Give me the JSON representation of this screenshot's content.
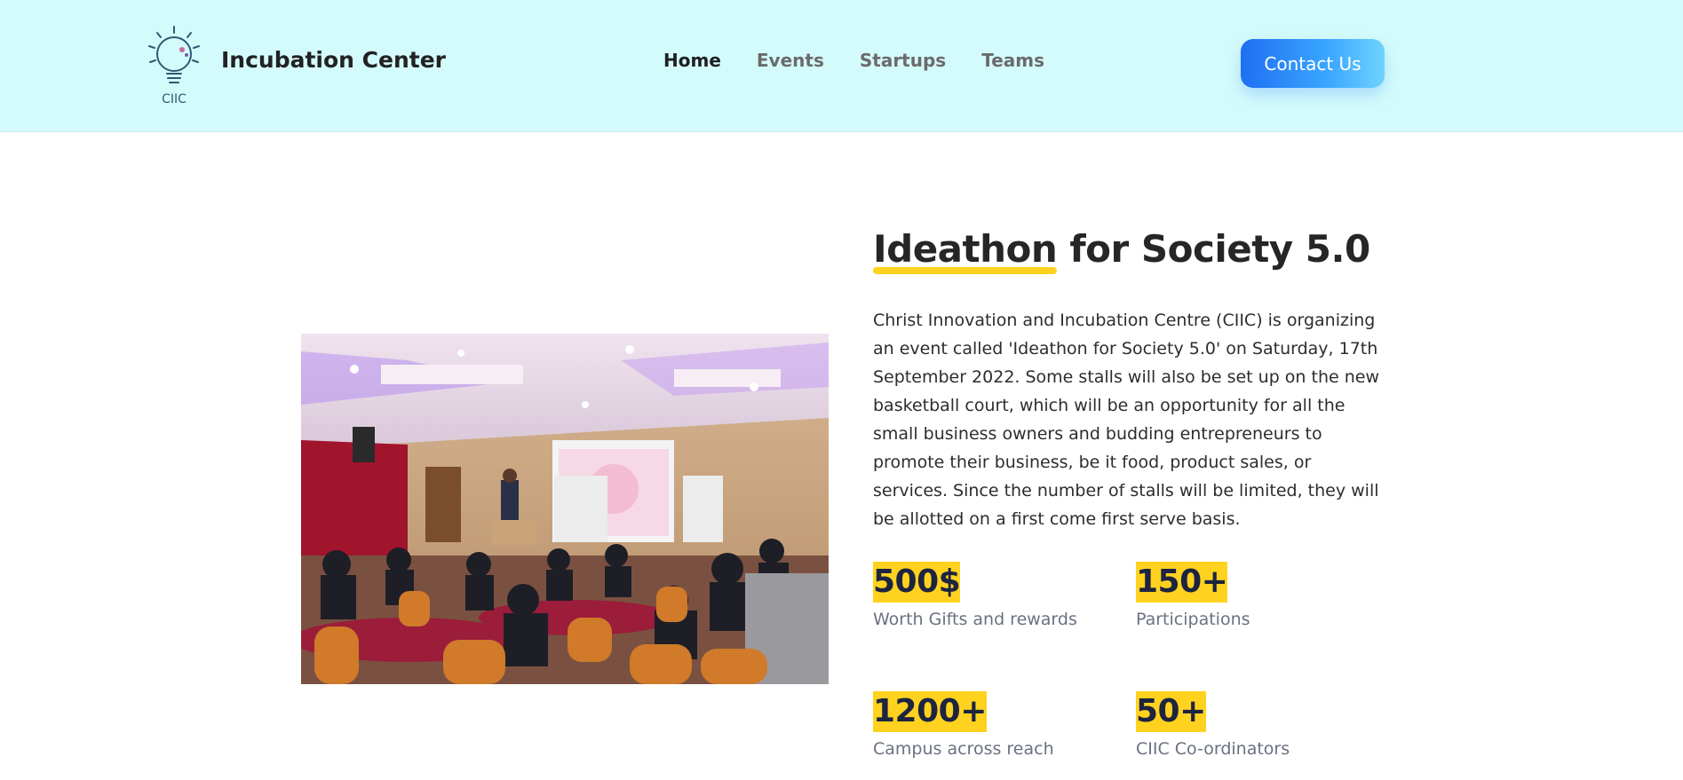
{
  "nav": {
    "brand_logo_text": "CIIC",
    "brand_name": "Incubation Center",
    "links": [
      {
        "label": "Home"
      },
      {
        "label": "Events"
      },
      {
        "label": "Startups"
      },
      {
        "label": "Teams"
      }
    ],
    "contact_label": "Contact Us"
  },
  "hero": {
    "title_highlight": "Ideathon",
    "title_rest": " for Society 5.0",
    "description": "Christ Innovation and Incubation Centre (CIIC) is organizing an event called 'Ideathon for Society 5.0' on Saturday, 17th September 2022. Some stalls will also be set up on the new basketball court, which will be an opportunity for all the small business owners and budding entrepreneurs to promote their business, be it food, product sales, or services. Since the number of stalls will be limited, they will be allotted on a first come first serve basis."
  },
  "stats": [
    {
      "value": "500$",
      "label": " Worth Gifts and rewards"
    },
    {
      "value": "150+",
      "label": "Participations"
    },
    {
      "value": "1200+",
      "label": "Campus across reach"
    },
    {
      "value": "50+",
      "label": "CIIC Co-ordinators"
    }
  ],
  "colors": {
    "nav_background": "#d4fbfb",
    "accent_yellow": "#ffd21f",
    "button_gradient_start": "#1f6ff2",
    "button_gradient_end": "#6fd3ff"
  },
  "icons": {
    "brand_logo": "lightbulb-logo-icon"
  }
}
